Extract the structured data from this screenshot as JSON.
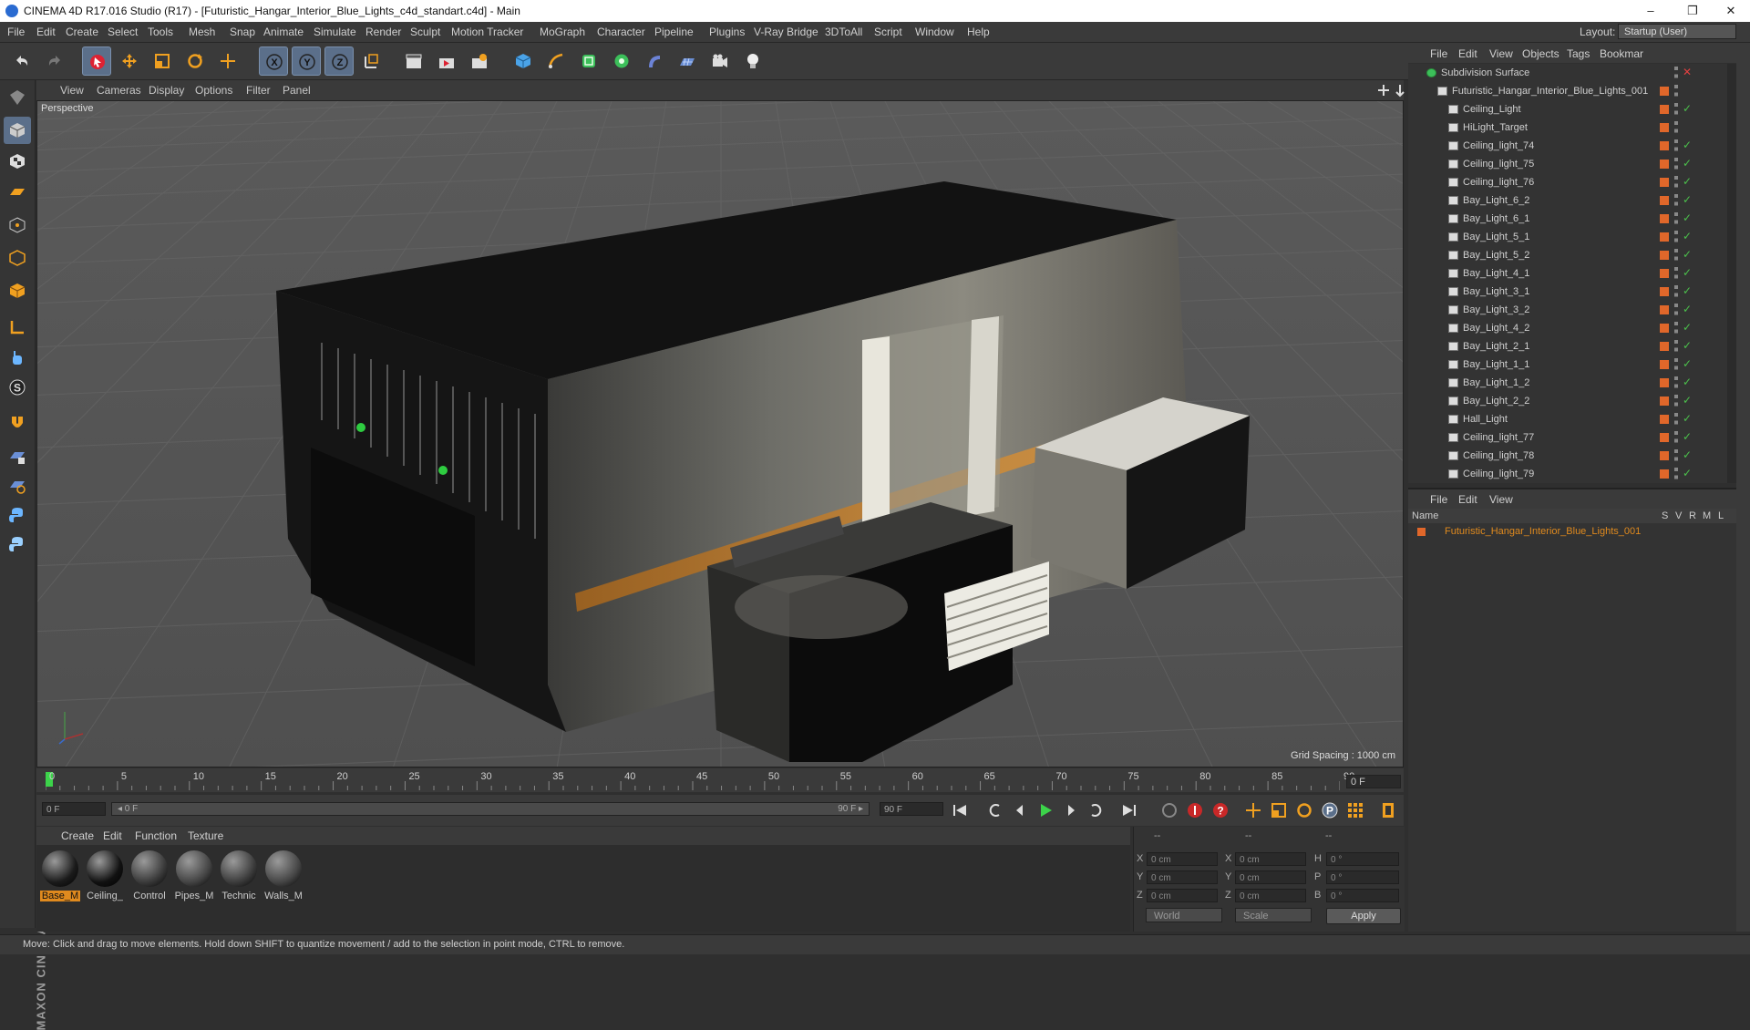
{
  "window": {
    "title": "CINEMA 4D R17.016 Studio (R17) - [Futuristic_Hangar_Interior_Blue_Lights_c4d_standart.c4d] - Main",
    "minimize": "–",
    "restore": "❐",
    "close": "✕"
  },
  "menubar": [
    "File",
    "Edit",
    "Create",
    "Select",
    "Tools",
    "Mesh",
    "Snap",
    "Animate",
    "Simulate",
    "Render",
    "Sculpt",
    "Motion Tracker",
    "MoGraph",
    "Character",
    "Pipeline",
    "Plugins",
    "V-Ray Bridge",
    "3DToAll",
    "Script",
    "Window",
    "Help"
  ],
  "layout": {
    "label": "Layout:",
    "value": "Startup (User)"
  },
  "viewport": {
    "menu": [
      "View",
      "Cameras",
      "Display",
      "Options",
      "Filter",
      "Panel"
    ],
    "label": "Perspective",
    "grid_spacing": "Grid Spacing : 1000 cm"
  },
  "timeline": {
    "ticks": [
      "0",
      "5",
      "10",
      "15",
      "20",
      "25",
      "30",
      "35",
      "40",
      "45",
      "50",
      "55",
      "60",
      "65",
      "70",
      "75",
      "80",
      "85",
      "90"
    ],
    "current_frame": "0 F"
  },
  "transport": {
    "start_field": "0 F",
    "range_start": "◂ 0 F",
    "range_end": "90 F ▸",
    "end_field": "90 F"
  },
  "materials": {
    "menu": [
      "Create",
      "Edit",
      "Function",
      "Texture"
    ],
    "items": [
      {
        "label": "Base_M",
        "color": "#1a1a1a"
      },
      {
        "label": "Ceiling_",
        "color": "#111111"
      },
      {
        "label": "Control",
        "color": "#3a3a3a"
      },
      {
        "label": "Pipes_M",
        "color": "#444444"
      },
      {
        "label": "Technic",
        "color": "#3c3c3c"
      },
      {
        "label": "Walls_M",
        "color": "#454545"
      }
    ]
  },
  "coords": {
    "header": [
      "--",
      "--",
      "--"
    ],
    "rows": [
      {
        "a": "X",
        "av": "0 cm",
        "b": "X",
        "bv": "0 cm",
        "c": "H",
        "cv": "0 °"
      },
      {
        "a": "Y",
        "av": "0 cm",
        "b": "Y",
        "bv": "0 cm",
        "c": "P",
        "cv": "0 °"
      },
      {
        "a": "Z",
        "av": "0 cm",
        "b": "Z",
        "bv": "0 cm",
        "c": "B",
        "cv": "0 °"
      }
    ],
    "world": "World",
    "scale": "Scale",
    "apply": "Apply"
  },
  "object_manager": {
    "menu": [
      "File",
      "Edit",
      "View",
      "Objects",
      "Tags",
      "Bookmar"
    ],
    "items": [
      {
        "name": "Subdivision Surface",
        "indent": 0,
        "check": false
      },
      {
        "name": "Futuristic_Hangar_Interior_Blue_Lights_001",
        "indent": 1,
        "check": false
      },
      {
        "name": "Ceiling_Light",
        "indent": 2,
        "check": true
      },
      {
        "name": "HiLight_Target",
        "indent": 2,
        "check": false
      },
      {
        "name": "Ceiling_light_74",
        "indent": 2,
        "check": true
      },
      {
        "name": "Ceiling_light_75",
        "indent": 2,
        "check": true
      },
      {
        "name": "Ceiling_light_76",
        "indent": 2,
        "check": true
      },
      {
        "name": "Bay_Light_6_2",
        "indent": 2,
        "check": true
      },
      {
        "name": "Bay_Light_6_1",
        "indent": 2,
        "check": true
      },
      {
        "name": "Bay_Light_5_1",
        "indent": 2,
        "check": true
      },
      {
        "name": "Bay_Light_5_2",
        "indent": 2,
        "check": true
      },
      {
        "name": "Bay_Light_4_1",
        "indent": 2,
        "check": true
      },
      {
        "name": "Bay_Light_3_1",
        "indent": 2,
        "check": true
      },
      {
        "name": "Bay_Light_3_2",
        "indent": 2,
        "check": true
      },
      {
        "name": "Bay_Light_4_2",
        "indent": 2,
        "check": true
      },
      {
        "name": "Bay_Light_2_1",
        "indent": 2,
        "check": true
      },
      {
        "name": "Bay_Light_1_1",
        "indent": 2,
        "check": true
      },
      {
        "name": "Bay_Light_1_2",
        "indent": 2,
        "check": true
      },
      {
        "name": "Bay_Light_2_2",
        "indent": 2,
        "check": true
      },
      {
        "name": "Hall_Light",
        "indent": 2,
        "check": true
      },
      {
        "name": "Ceiling_light_77",
        "indent": 2,
        "check": true
      },
      {
        "name": "Ceiling_light_78",
        "indent": 2,
        "check": true
      },
      {
        "name": "Ceiling_light_79",
        "indent": 2,
        "check": true
      }
    ]
  },
  "layer_manager": {
    "menu": [
      "File",
      "Edit",
      "View"
    ],
    "columns": [
      "Name",
      "S",
      "V",
      "R",
      "M",
      "L"
    ],
    "row": "Futuristic_Hangar_Interior_Blue_Lights_001"
  },
  "status": "Move: Click and drag to move elements. Hold down SHIFT to quantize movement / add to the selection in point mode, CTRL to remove.",
  "colors": {
    "accent_orange": "#e08a1e",
    "selection_blue": "#5b6f8a",
    "panel": "#3a3a3a",
    "viewport": "#565656"
  }
}
